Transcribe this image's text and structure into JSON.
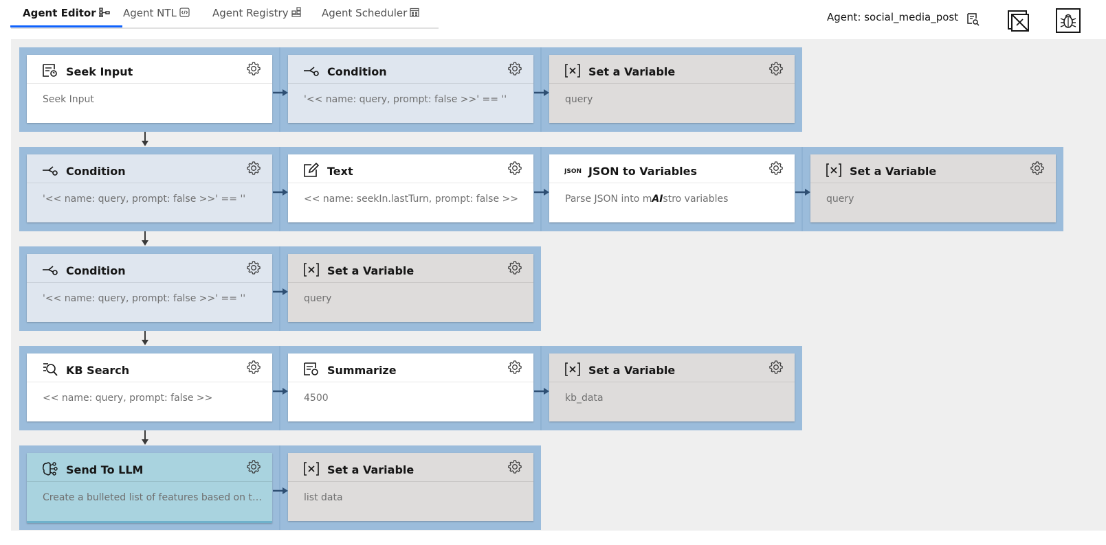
{
  "tabs": [
    {
      "label": "Agent Editor",
      "icon": "flow-icon",
      "active": true
    },
    {
      "label": "Agent NTL",
      "icon": "code-icon",
      "active": false
    },
    {
      "label": "Agent Registry",
      "icon": "registry-icon",
      "active": false
    },
    {
      "label": "Agent Scheduler",
      "icon": "calendar-icon",
      "active": false
    }
  ],
  "header": {
    "agent_label": "Agent: social_media_post",
    "icons": [
      "search-document-icon",
      "export-icon",
      "debug-icon"
    ]
  },
  "colors": {
    "accent": "#0f62fe",
    "row_bg": "#9bbcdb",
    "condition_card": "#dfe6ef",
    "variable_card": "#dedcdb",
    "llm_card": "#a9d3df"
  },
  "rows": [
    {
      "cards": [
        {
          "title": "Seek Input",
          "body": "Seek Input",
          "icon": "seek-input-icon",
          "kind": "plain"
        },
        {
          "title": "Condition",
          "body": "'<< name: query, prompt: false >>' == ''",
          "icon": "branch-icon",
          "kind": "cond"
        },
        {
          "title": "Set a Variable",
          "body": "query",
          "icon": "variable-icon",
          "kind": "var"
        }
      ]
    },
    {
      "cards": [
        {
          "title": "Condition",
          "body": "'<< name: query, prompt: false >>' == ''",
          "icon": "branch-icon",
          "kind": "cond"
        },
        {
          "title": "Text",
          "body": "<< name: seekIn.lastTurn, prompt: false >>",
          "icon": "edit-icon",
          "kind": "plain"
        },
        {
          "title": "JSON to Variables",
          "body_pre": "Parse JSON into m",
          "body_ai": "AI",
          "body_post": "stro variables",
          "icon": "json-icon",
          "kind": "plain"
        },
        {
          "title": "Set a Variable",
          "body": "query",
          "icon": "variable-icon",
          "kind": "var"
        }
      ]
    },
    {
      "cards": [
        {
          "title": "Condition",
          "body": "'<< name: query, prompt: false >>' == ''",
          "icon": "branch-icon",
          "kind": "cond"
        },
        {
          "title": "Set a Variable",
          "body": "query",
          "icon": "variable-icon",
          "kind": "var"
        }
      ]
    },
    {
      "cards": [
        {
          "title": "KB Search",
          "body": "<< name: query, prompt: false >>",
          "icon": "kb-search-icon",
          "kind": "plain"
        },
        {
          "title": "Summarize",
          "body": "4500",
          "icon": "summarize-icon",
          "kind": "plain"
        },
        {
          "title": "Set a Variable",
          "body": "kb_data",
          "icon": "variable-icon",
          "kind": "var"
        }
      ]
    },
    {
      "cards": [
        {
          "title": "Send To LLM",
          "body": "Create a bulleted list of features based on the data",
          "icon": "llm-icon",
          "kind": "llm"
        },
        {
          "title": "Set a Variable",
          "body": "list  data",
          "icon": "variable-icon",
          "kind": "var"
        }
      ]
    }
  ]
}
